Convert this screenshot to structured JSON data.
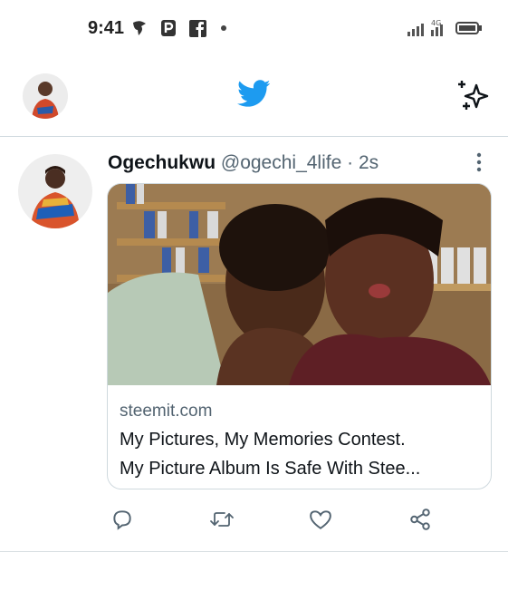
{
  "status_bar": {
    "time": "9:41",
    "icons": [
      "app-notification-icon",
      "p-icon",
      "facebook-icon",
      "dot-icon",
      "signal-4g-icon",
      "battery-icon"
    ],
    "network_label": "4G"
  },
  "header": {
    "logo_icon": "twitter-bird-icon",
    "sparkle_icon": "sparkle-icon",
    "brand_color": "#1d9bf0"
  },
  "tweet": {
    "display_name": "Ogechukwu",
    "handle": "@ogechi_4life",
    "separator": "·",
    "time_ago": "2s",
    "card": {
      "domain": "steemit.com",
      "title_line1": "My Pictures, My Memories Contest.",
      "title_line2": "My Picture Album Is Safe With Stee..."
    },
    "actions": [
      "reply-icon",
      "retweet-icon",
      "like-icon",
      "share-icon"
    ]
  }
}
